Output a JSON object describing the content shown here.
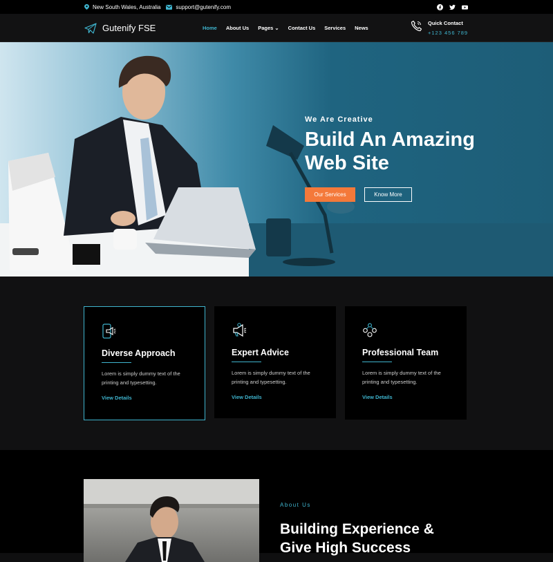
{
  "topbar": {
    "location": "New South Wales, Australia",
    "email": "support@gutenify.com",
    "social": [
      "facebook-icon",
      "twitter-icon",
      "youtube-icon"
    ]
  },
  "header": {
    "logo_text": "Gutenify FSE",
    "nav": [
      {
        "label": "Home",
        "active": true
      },
      {
        "label": "About Us"
      },
      {
        "label": "Pages ⌄"
      },
      {
        "label": "Contact Us"
      },
      {
        "label": "Services"
      },
      {
        "label": "News"
      }
    ],
    "quick_contact_label": "Quick Contact",
    "quick_contact_phone": "+123 456 789"
  },
  "hero": {
    "kicker": "We Are Creative",
    "title": "Build An Amazing Web Site",
    "primary_button": "Our Services",
    "secondary_button": "Know More"
  },
  "features": [
    {
      "title": "Diverse Approach",
      "text": "Lorem is simply dummy text of the printing and typesetting.",
      "link": "View Details",
      "icon": "mobile-megaphone-icon"
    },
    {
      "title": "Expert Advice",
      "text": "Lorem is simply dummy text of the printing and typesetting.",
      "link": "View Details",
      "icon": "megaphone-icon"
    },
    {
      "title": "Professional Team",
      "text": "Lorem is simply dummy text of the printing and typesetting.",
      "link": "View Details",
      "icon": "team-icon"
    }
  ],
  "about": {
    "kicker": "About Us",
    "title": "Building Experience & Give High Success"
  },
  "colors": {
    "accent": "#3fb5cf",
    "orange": "#f4793a",
    "dark": "#000000"
  }
}
